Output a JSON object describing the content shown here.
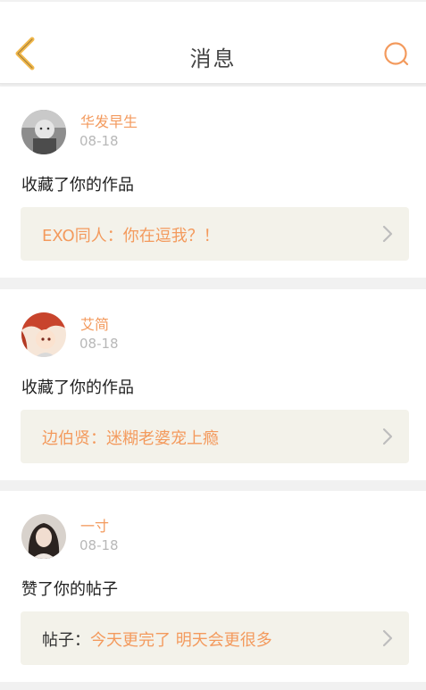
{
  "header": {
    "title": "消息",
    "icons": {
      "back": "chevron-left-icon",
      "search": "search-icon"
    },
    "accent_color": "#f2b84b",
    "search_color": "#f39a5d"
  },
  "notifications": [
    {
      "username": "华发早生",
      "date": "08-18",
      "action": "收藏了你的作品",
      "ref_prefix": "",
      "ref_text": "EXO同人：你在逗我？！"
    },
    {
      "username": "艾简",
      "date": "08-18",
      "action": "收藏了你的作品",
      "ref_prefix": "",
      "ref_text": "边伯贤：迷糊老婆宠上瘾"
    },
    {
      "username": "一寸",
      "date": "08-18",
      "action": "赞了你的帖子",
      "ref_prefix": "帖子：",
      "ref_text": "今天更完了 明天会更很多"
    }
  ],
  "colors": {
    "name": "#f39a5d",
    "date": "#b8b8b8",
    "ref_bg": "#f3f2ea"
  }
}
